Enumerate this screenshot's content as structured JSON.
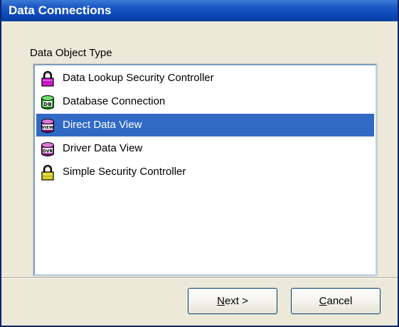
{
  "window": {
    "title": "Data Connections"
  },
  "group": {
    "label": "Data Object Type"
  },
  "list": {
    "items": [
      {
        "label": "Data Lookup Security Controller",
        "icon": "padlock-magenta-icon",
        "color": "#d61ad6",
        "selected": false
      },
      {
        "label": "Database Connection",
        "icon": "database-db-icon",
        "color": "#1fb51f",
        "badge": "DB",
        "selected": false
      },
      {
        "label": "Direct Data View",
        "icon": "view-icon",
        "color": "#a21aa2",
        "badge": "VIEW",
        "selected": true
      },
      {
        "label": "Driver Data View",
        "icon": "dvr-icon",
        "color": "#a21aa2",
        "badge": "DVR",
        "selected": false
      },
      {
        "label": "Simple Security Controller",
        "icon": "padlock-yellow-icon",
        "color": "#d9d42a",
        "selected": false
      }
    ]
  },
  "buttons": {
    "next": {
      "mnemonic": "N",
      "rest": "ext >"
    },
    "cancel": {
      "mnemonic": "C",
      "rest": "ancel"
    }
  },
  "colors": {
    "selection": "#316ac5",
    "titlebar": "#0a48b8",
    "face": "#ece9d8"
  }
}
